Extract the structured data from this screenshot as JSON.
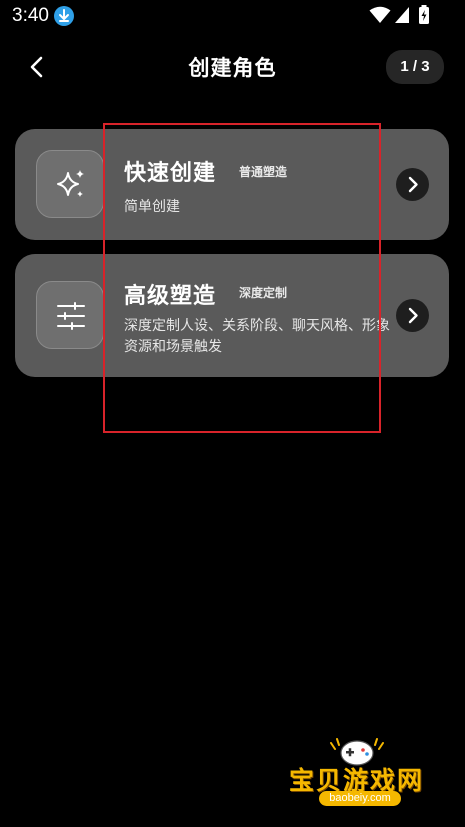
{
  "status_bar": {
    "time": "3:40"
  },
  "header": {
    "title": "创建角色",
    "page_counter": "1 / 3"
  },
  "cards": [
    {
      "title": "快速创建",
      "tag": "普通塑造",
      "description": "简单创建",
      "icon": "sparkle-icon"
    },
    {
      "title": "高级塑造",
      "tag": "深度定制",
      "description": "深度定制人设、关系阶段、聊天风格、形象资源和场景触发",
      "icon": "sliders-icon"
    }
  ],
  "watermark": {
    "text": "宝贝游戏网",
    "url": "baobeiy.com"
  },
  "colors": {
    "background": "#000000",
    "card": "#5a5a5a",
    "highlight": "#d8232a",
    "watermark": "#f5b800"
  }
}
